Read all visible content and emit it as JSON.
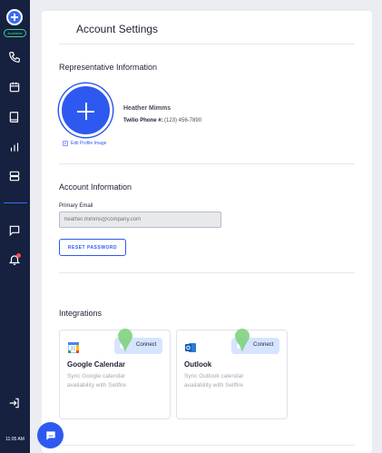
{
  "sidebar": {
    "status": "Available",
    "time": "11:05 AM",
    "notification_color": "#ff4d4d"
  },
  "page": {
    "title": "Account Settings"
  },
  "representative": {
    "heading": "Representative Information",
    "name": "Heather Mimms",
    "phone_label": "Twilio Phone #:",
    "phone_value": "(123) 456-7890",
    "edit_label": "Edit Profile Image"
  },
  "account": {
    "heading": "Account Information",
    "email_label": "Primary Email",
    "email_placeholder": "heather.mimms@company.com",
    "reset_label": "RESET PASSWORD"
  },
  "integrations": {
    "heading": "Integrations",
    "items": [
      {
        "name": "Google Calendar",
        "description": "Sync Google calendar availability with Sellfire",
        "connect_label": "Connect"
      },
      {
        "name": "Outlook",
        "description": "Sync Outlook calendar availability with Sellfire",
        "connect_label": "Connect"
      }
    ]
  },
  "colors": {
    "sidebar": "#15213f",
    "accent": "#2e59f0",
    "available": "#3fd18a",
    "pin": "#7fd17f"
  }
}
